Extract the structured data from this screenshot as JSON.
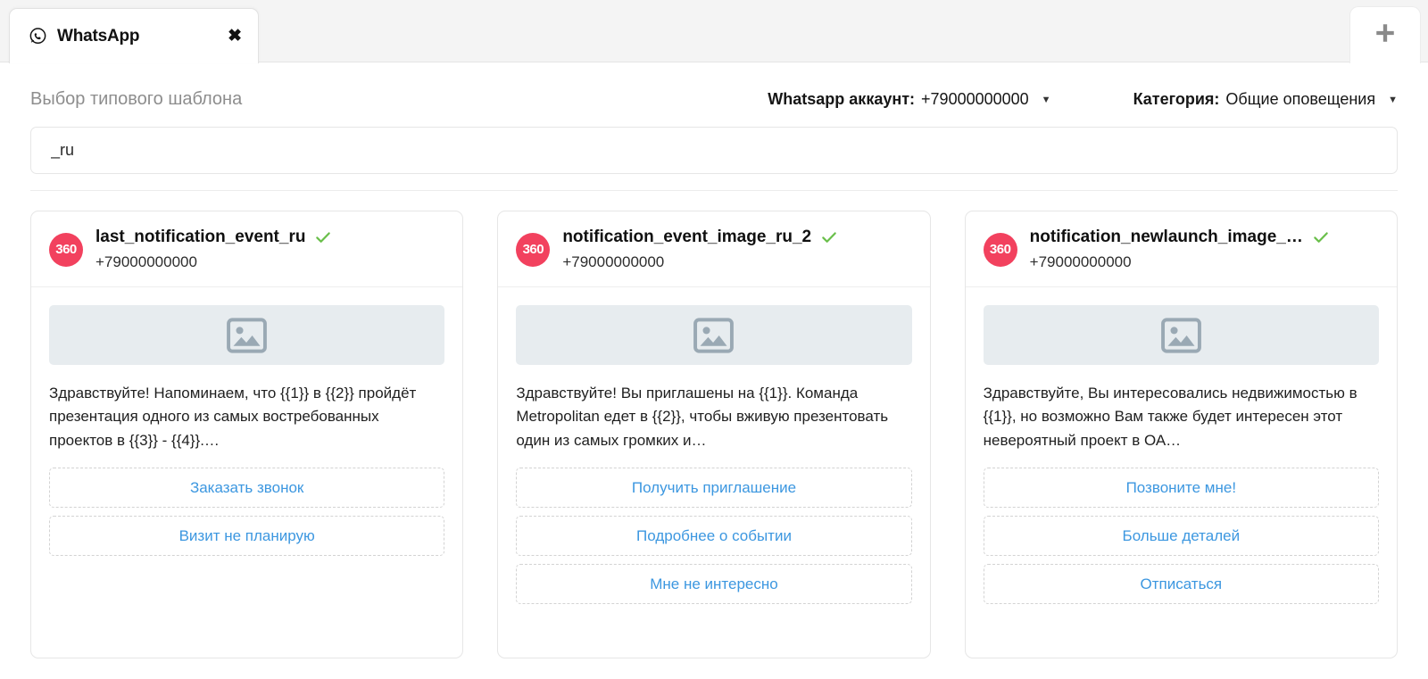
{
  "tab": {
    "icon": "whatsapp-icon",
    "label": "WhatsApp",
    "close_glyph": "✖",
    "new_tab_glyph": "✛"
  },
  "toolbar": {
    "title": "Выбор типового шаблона",
    "account": {
      "label": "Whatsapp аккаунт:",
      "value": "+79000000000",
      "caret": "▼"
    },
    "category": {
      "label": "Категория:",
      "value": "Общие оповещения",
      "caret": "▼"
    }
  },
  "search": {
    "value": "_ru",
    "placeholder": ""
  },
  "colors": {
    "accent_blue": "#3c97e0",
    "logo_pink": "#F2415E",
    "check_green": "#6abf4b",
    "placeholder_bg": "#e7ecef"
  },
  "cards": [
    {
      "logo_text": "360",
      "name": "last_notification_event_ru",
      "phone": "+79000000000",
      "approved": true,
      "image_icon": "image-placeholder-icon",
      "text": "Здравствуйте! Напоминаем, что {{1}} в {{2}} пройдёт презентация одного из самых востребованных проектов в {{3}} - {{4}}.…",
      "buttons": [
        "Заказать звонок",
        "Визит не планирую"
      ]
    },
    {
      "logo_text": "360",
      "name": "notification_event_image_ru_2",
      "phone": "+79000000000",
      "approved": true,
      "image_icon": "image-placeholder-icon",
      "text": "Здравствуйте! Вы приглашены на {{1}}. Команда Metropolitan едет в {{2}}, чтобы вживую презентовать один из самых громких и…",
      "buttons": [
        "Получить приглашение",
        "Подробнее о событии",
        "Мне не интересно"
      ]
    },
    {
      "logo_text": "360",
      "name": "notification_newlaunch_image_…",
      "phone": "+79000000000",
      "approved": true,
      "image_icon": "image-placeholder-icon",
      "text": "Здравствуйте, Вы интересовались недвижимостью в {{1}}, но возможно Вам также будет интересен этот невероятный проект в ОА…",
      "buttons": [
        "Позвоните мне!",
        "Больше деталей",
        "Отписаться"
      ]
    }
  ]
}
